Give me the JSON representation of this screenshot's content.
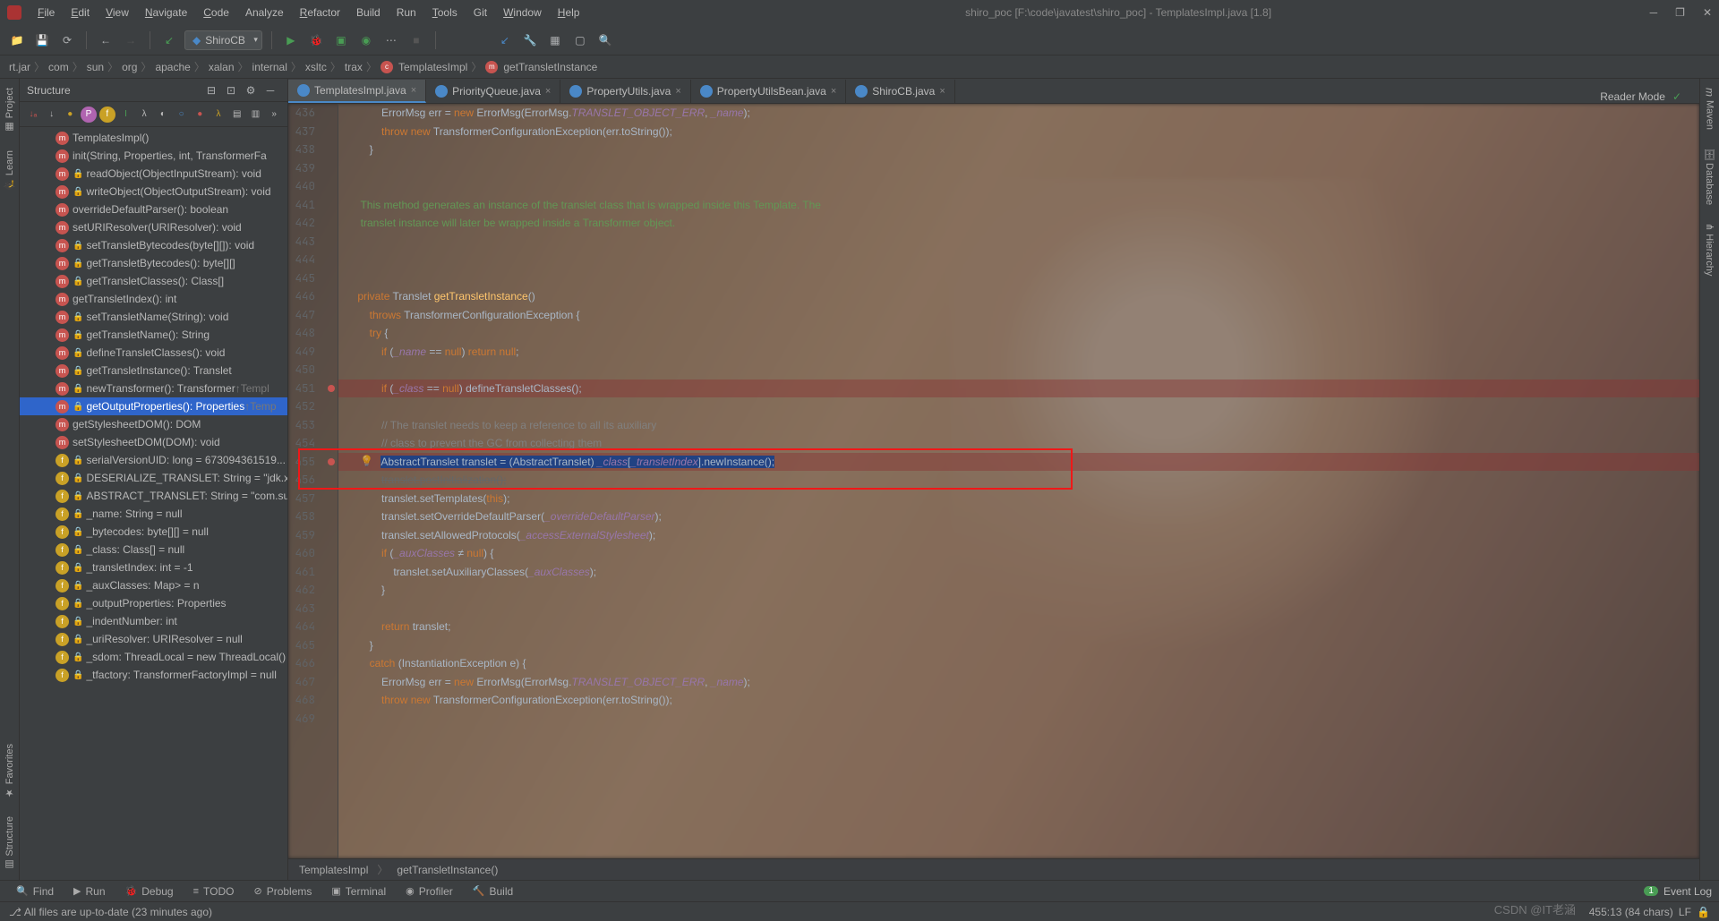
{
  "title": "shiro_poc [F:\\code\\javatest\\shiro_poc] - TemplatesImpl.java [1.8]",
  "menu": [
    "File",
    "Edit",
    "View",
    "Navigate",
    "Code",
    "Analyze",
    "Refactor",
    "Build",
    "Run",
    "Tools",
    "Git",
    "Window",
    "Help"
  ],
  "runConfig": "ShiroCB",
  "breadcrumbs": [
    "rt.jar",
    "com",
    "sun",
    "org",
    "apache",
    "xalan",
    "internal",
    "xsltc",
    "trax",
    "TemplatesImpl",
    "getTransletInstance"
  ],
  "tabs": [
    {
      "label": "TemplatesImpl.java",
      "active": true,
      "icon": "#4a88c7"
    },
    {
      "label": "PriorityQueue.java",
      "icon": "#4a88c7"
    },
    {
      "label": "PropertyUtils.java",
      "icon": "#4a88c7"
    },
    {
      "label": "PropertyUtilsBean.java",
      "icon": "#4a88c7"
    },
    {
      "label": "ShiroCB.java",
      "icon": "#4a88c7"
    }
  ],
  "readerMode": "Reader Mode",
  "structure": {
    "title": "Structure",
    "items": [
      {
        "i": "m",
        "t": "TemplatesImpl()"
      },
      {
        "i": "m",
        "t": "init(String, Properties, int, TransformerFa"
      },
      {
        "i": "m",
        "t": "readObject(ObjectInputStream): void",
        "lock": true
      },
      {
        "i": "m",
        "t": "writeObject(ObjectOutputStream): void",
        "lock": true
      },
      {
        "i": "m",
        "t": "overrideDefaultParser(): boolean"
      },
      {
        "i": "m",
        "t": "setURIResolver(URIResolver): void"
      },
      {
        "i": "m",
        "t": "setTransletBytecodes(byte[][]): void",
        "lock": true
      },
      {
        "i": "m",
        "t": "getTransletBytecodes(): byte[][]",
        "lock": true
      },
      {
        "i": "m",
        "t": "getTransletClasses(): Class[]",
        "lock": true
      },
      {
        "i": "m",
        "t": "getTransletIndex(): int"
      },
      {
        "i": "m",
        "t": "setTransletName(String): void",
        "lock": true
      },
      {
        "i": "m",
        "t": "getTransletName(): String",
        "lock": true
      },
      {
        "i": "m",
        "t": "defineTransletClasses(): void",
        "lock": true
      },
      {
        "i": "m",
        "t": "getTransletInstance(): Translet",
        "lock": true
      },
      {
        "i": "m",
        "t": "newTransformer(): Transformer",
        "inh": "↑Templ",
        "lock": true
      },
      {
        "i": "m",
        "t": "getOutputProperties(): Properties",
        "inh": "↑Temp",
        "sel": true,
        "lock": true
      },
      {
        "i": "m",
        "t": "getStylesheetDOM(): DOM"
      },
      {
        "i": "m",
        "t": "setStylesheetDOM(DOM): void"
      },
      {
        "i": "f",
        "t": "serialVersionUID: long = 673094361519...",
        "lock": true
      },
      {
        "i": "f",
        "t": "DESERIALIZE_TRANSLET: String = \"jdk.xn",
        "lock": true
      },
      {
        "i": "f",
        "t": "ABSTRACT_TRANSLET: String = \"com.sun",
        "lock": true
      },
      {
        "i": "f",
        "t": "_name: String = null",
        "lock": true
      },
      {
        "i": "f",
        "t": "_bytecodes: byte[][] = null",
        "lock": true
      },
      {
        "i": "f",
        "t": "_class: Class[] = null",
        "lock": true
      },
      {
        "i": "f",
        "t": "_transletIndex: int = -1",
        "lock": true
      },
      {
        "i": "f",
        "t": "_auxClasses: Map<String, Class<?>> = n",
        "lock": true
      },
      {
        "i": "f",
        "t": "_outputProperties: Properties",
        "lock": true
      },
      {
        "i": "f",
        "t": "_indentNumber: int",
        "lock": true
      },
      {
        "i": "f",
        "t": "_uriResolver: URIResolver = null",
        "lock": true
      },
      {
        "i": "f",
        "t": "_sdom: ThreadLocal = new ThreadLocal()",
        "lock": true
      },
      {
        "i": "f",
        "t": "_tfactory: TransformerFactoryImpl = null",
        "lock": true
      }
    ]
  },
  "lines": [
    436,
    437,
    438,
    439,
    440,
    441,
    442,
    443,
    444,
    445,
    446,
    447,
    448,
    449,
    450,
    451,
    452,
    453,
    454,
    455,
    456,
    457,
    458,
    459,
    460,
    461,
    462,
    463,
    464,
    465,
    466,
    467,
    468,
    469
  ],
  "code": {
    "436": "            ErrorMsg err = new ErrorMsg(ErrorMsg.TRANSLET_OBJECT_ERR, _name);",
    "437": "            throw new TransformerConfigurationException(err.toString());",
    "438": "        }",
    "440": "",
    "441": "     This method generates an instance of the translet class that is wrapped inside this Template. The",
    "442": "     translet instance will later be wrapped inside a Transformer object.",
    "446": "    private Translet getTransletInstance()",
    "447": "        throws TransformerConfigurationException {",
    "448": "        try {",
    "449": "            if (_name == null) return null;",
    "451": "            if (_class == null) defineTransletClasses();",
    "453": "            // The translet needs to keep a reference to all its auxiliary",
    "454": "            // class to prevent the GC from collecting them",
    "455": "            AbstractTranslet translet = (AbstractTranslet) _class[_transletIndex].newInstance();",
    "456": "            translet.postInitialization();",
    "457": "            translet.setTemplates(this);",
    "458": "            translet.setOverrideDefaultParser(_overrideDefaultParser);",
    "459": "            translet.setAllowedProtocols(_accessExternalStylesheet);",
    "460": "            if (_auxClasses != null) {",
    "461": "                translet.setAuxiliaryClasses(_auxClasses);",
    "462": "            }",
    "464": "            return translet;",
    "465": "        }",
    "466": "        catch (InstantiationException e) {",
    "467": "            ErrorMsg err = new ErrorMsg(ErrorMsg.TRANSLET_OBJECT_ERR, _name);",
    "468": "            throw new TransformerConfigurationException(err.toString());"
  },
  "edCrumbs": [
    "TemplatesImpl",
    "getTransletInstance()"
  ],
  "bottomTabs": [
    "Find",
    "Run",
    "Debug",
    "TODO",
    "Problems",
    "Terminal",
    "Profiler",
    "Build"
  ],
  "eventLog": "Event Log",
  "status": {
    "msg": "All files are up-to-date (23 minutes ago)",
    "cursor": "455:13 (84 chars)",
    "le": "LF",
    "enc": "",
    "branch": ""
  },
  "watermark": "CSDN @IT老涵"
}
